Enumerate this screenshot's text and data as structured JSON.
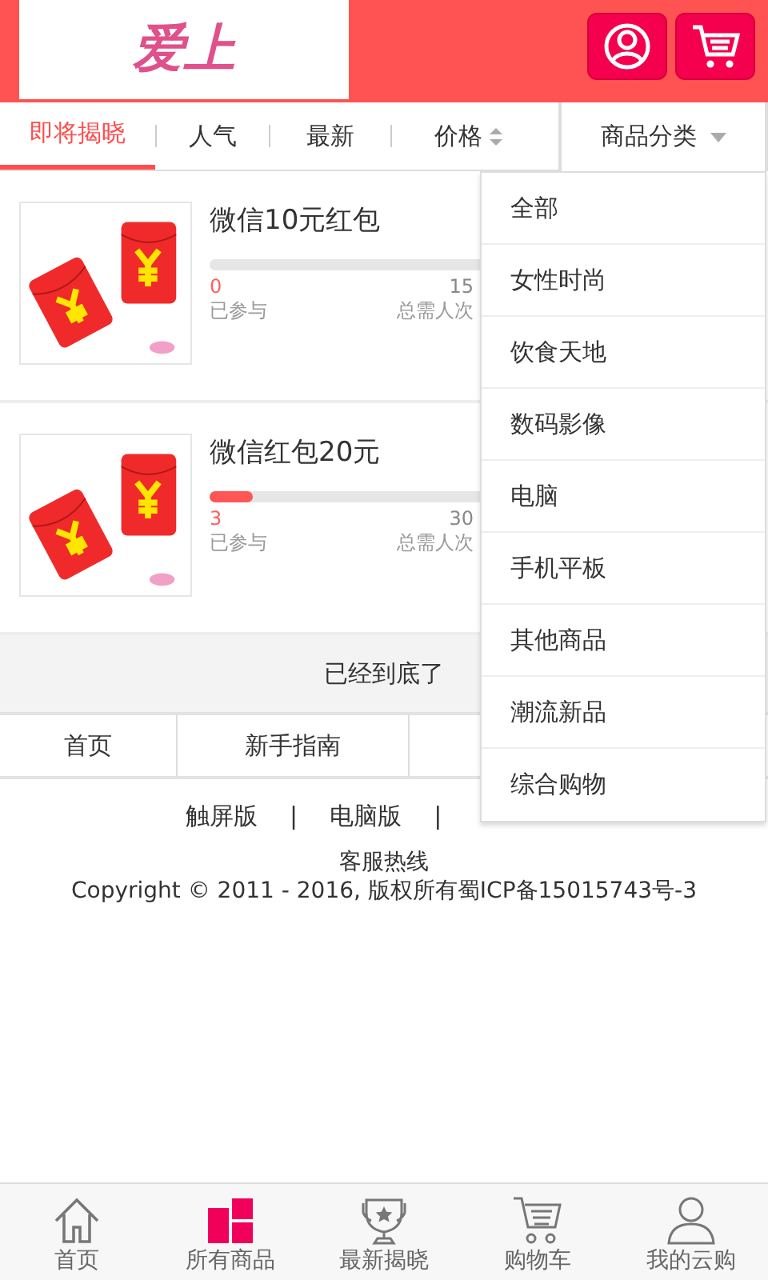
{
  "header": {
    "logo_text": "爱上"
  },
  "tabs": [
    {
      "label": "即将揭晓",
      "selected": true,
      "sortable": false
    },
    {
      "label": "人气",
      "selected": false,
      "sortable": false
    },
    {
      "label": "最新",
      "selected": false,
      "sortable": false
    },
    {
      "label": "价格",
      "selected": false,
      "sortable": true
    }
  ],
  "category": {
    "label": "商品分类",
    "expanded": true,
    "items": [
      "全部",
      "女性时尚",
      "饮食天地",
      "数码影像",
      "电脑",
      "手机平板",
      "其他商品",
      "潮流新品",
      "综合购物"
    ]
  },
  "products": [
    {
      "title": "微信10元红包",
      "level": 0,
      "joined": "0",
      "joined_label": "已参与",
      "total": "15",
      "total_label": "总需人次"
    },
    {
      "title": "微信红包20元",
      "level": 0.1,
      "joined": "3",
      "joined_label": "已参与",
      "total": "30",
      "total_label": "总需人次"
    }
  ],
  "end_notice": "已经到底了",
  "footer_nav": [
    "首页",
    "新手指南"
  ],
  "footer_links": [
    "触屏版",
    "电脑版"
  ],
  "link_separator": "|",
  "hotline": "客服热线",
  "copyright": "Copyright © 2011 - 2016, 版权所有蜀ICP备15015743号-3",
  "bottom_nav": [
    {
      "label": "首页",
      "kind": "home",
      "selected": false
    },
    {
      "label": "所有商品",
      "kind": "grid",
      "selected": true
    },
    {
      "label": "最新揭晓",
      "kind": "trophy",
      "selected": false
    },
    {
      "label": "购物车",
      "kind": "cart",
      "selected": false
    },
    {
      "label": "我的云购",
      "kind": "person",
      "selected": false
    }
  ]
}
